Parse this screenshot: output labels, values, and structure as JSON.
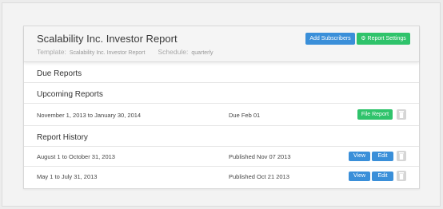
{
  "header": {
    "title": "Scalability Inc. Investor Report",
    "template_label": "Template:",
    "template_value": "Scalability Inc. Investor Report",
    "schedule_label": "Schedule:",
    "schedule_value": "quarterly",
    "add_subscribers_label": "Add Subscribers",
    "report_settings_label": "Report Settings"
  },
  "sections": {
    "due": "Due Reports",
    "upcoming": "Upcoming Reports",
    "history": "Report History"
  },
  "upcoming": [
    {
      "period": "November 1, 2013 to January 30, 2014",
      "status": "Due Feb 01",
      "action_label": "File Report"
    }
  ],
  "history": [
    {
      "period": "August 1 to October 31, 2013",
      "status": "Published Nov 07 2013",
      "view_label": "View",
      "edit_label": "Edit"
    },
    {
      "period": "May 1 to July 31, 2013",
      "status": "Published Oct 21 2013",
      "view_label": "View",
      "edit_label": "Edit"
    }
  ],
  "colors": {
    "primary": "#3a8fd9",
    "success": "#2fc36b",
    "muted": "#d6d6d6"
  }
}
